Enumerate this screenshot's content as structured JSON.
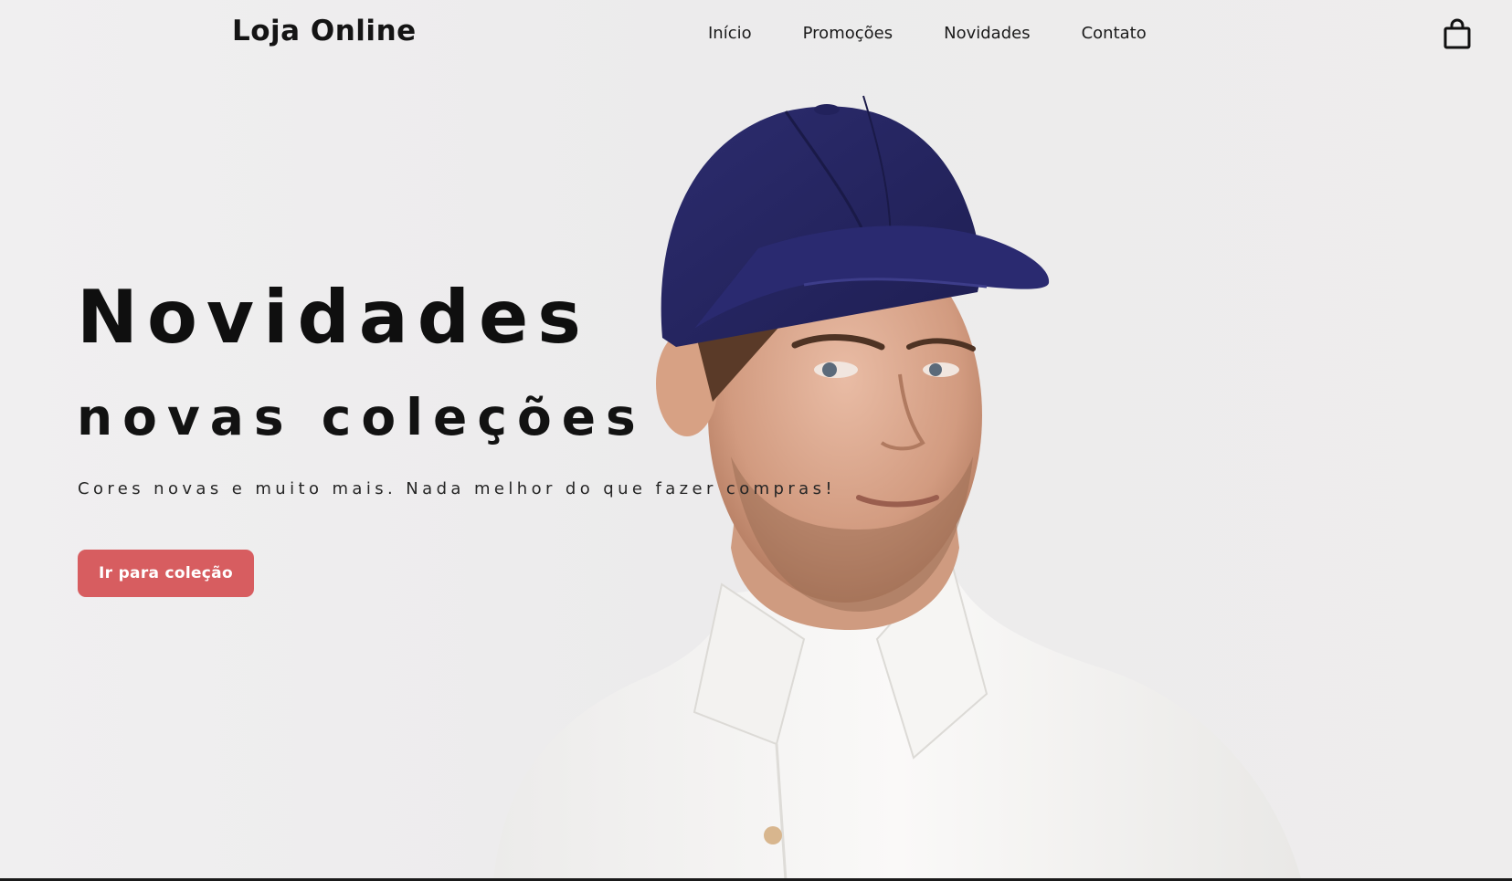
{
  "header": {
    "brand": "Loja Online",
    "nav": [
      "Início",
      "Promoções",
      "Novidades",
      "Contato"
    ]
  },
  "hero": {
    "title": "Novidades",
    "subtitle": "novas coleções",
    "text": "Cores novas e muito mais. Nada melhor do que fazer compras!",
    "button_label": "Ir para coleção"
  },
  "icons": {
    "cart": "shopping-bag-icon"
  },
  "colors": {
    "background": "#ecebec",
    "accent": "#d75d60",
    "cap": "#26265e",
    "shirt": "#f7f6f4",
    "text": "#111111"
  }
}
